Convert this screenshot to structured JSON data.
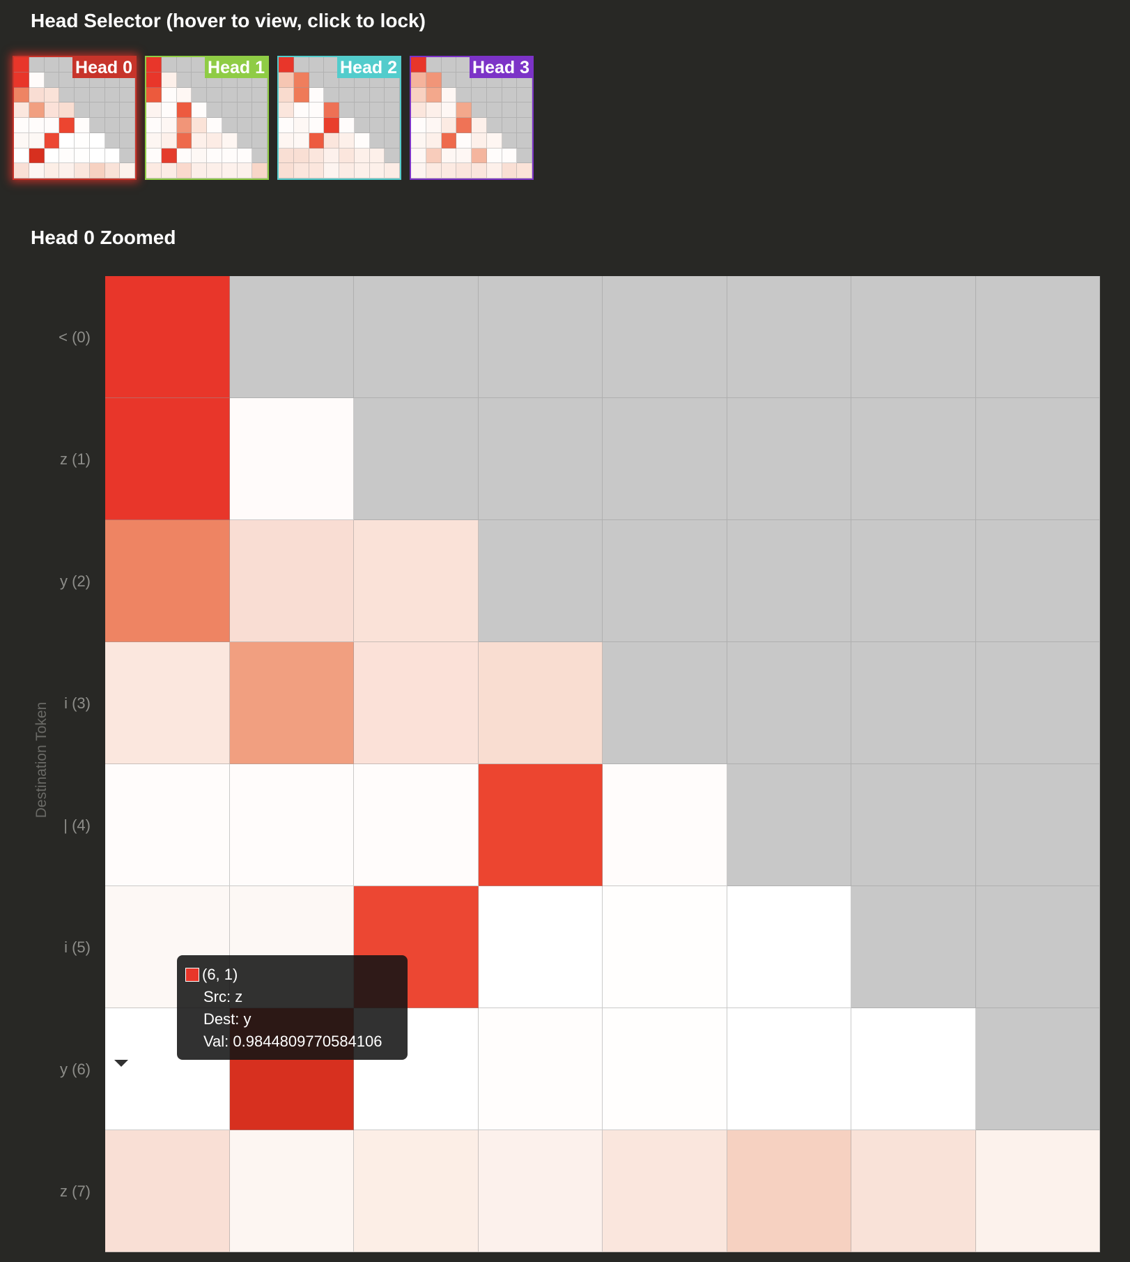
{
  "selector": {
    "title": "Head Selector (hover to view, click to lock)"
  },
  "zoom": {
    "title": "Head 0 Zoomed",
    "axis_label": "Destination Token"
  },
  "tokens": [
    "< (0)",
    "z (1)",
    "y (2)",
    "i (3)",
    "| (4)",
    "i (5)",
    "y (6)",
    "z (7)"
  ],
  "masked_color": "#c8c8c8",
  "heads": [
    {
      "label": "Head 0",
      "color": "#c7342a",
      "active": true,
      "cells": [
        [
          "#e8362a",
          null,
          null,
          null,
          null,
          null,
          null,
          null
        ],
        [
          "#e8362a",
          "#fffbfa",
          null,
          null,
          null,
          null,
          null,
          null
        ],
        [
          "#ee8463",
          "#f9ddd3",
          "#fae2d8",
          null,
          null,
          null,
          null,
          null
        ],
        [
          "#fbe7de",
          "#f19f80",
          "#fbe1d8",
          "#f9ddd1",
          null,
          null,
          null,
          null
        ],
        [
          "#fffcfb",
          "#fffcfb",
          "#fffcfb",
          "#ec4530",
          "#fffcfb",
          null,
          null,
          null
        ],
        [
          "#fdf8f5",
          "#fdf8f5",
          "#ec4733",
          "#ffffff",
          "#fffefd",
          "#ffffff",
          null,
          null
        ],
        [
          "#ffffff",
          "#d7301f",
          "#ffffff",
          "#fffdfc",
          "#fffefd",
          "#ffffff",
          "#ffffff",
          null
        ],
        [
          "#f9dfd5",
          "#fdf6f2",
          "#fceee6",
          "#fcf1ec",
          "#fae6dd",
          "#f6d1c1",
          "#f9e2d8",
          "#fcf2ec"
        ]
      ]
    },
    {
      "label": "Head 1",
      "color": "#8fcc45",
      "active": false,
      "cells": [
        [
          "#e8362a",
          null,
          null,
          null,
          null,
          null,
          null,
          null
        ],
        [
          "#e8362a",
          "#fdf0ea",
          null,
          null,
          null,
          null,
          null,
          null
        ],
        [
          "#ec5a3d",
          "#fffcfb",
          "#fef7f4",
          null,
          null,
          null,
          null,
          null
        ],
        [
          "#fdf4f0",
          "#fffcfb",
          "#ed5a3f",
          "#fffcfb",
          null,
          null,
          null,
          null
        ],
        [
          "#fffcfb",
          "#fef7f4",
          "#f19578",
          "#fbe3d8",
          "#fffcfb",
          null,
          null,
          null
        ],
        [
          "#fdf6f2",
          "#fdf0ea",
          "#ee6a4c",
          "#fdf0ea",
          "#fcece5",
          "#fef6f2",
          null,
          null
        ],
        [
          "#fffcfb",
          "#e43c2c",
          "#fffcfb",
          "#fef8f5",
          "#fffcfb",
          "#fffcfb",
          "#fffcfb",
          null
        ],
        [
          "#fceae2",
          "#fcece5",
          "#fad9cd",
          "#fceee8",
          "#fcefe9",
          "#fdf1ec",
          "#fcf1ec",
          "#f8d6c8"
        ]
      ]
    },
    {
      "label": "Head 2",
      "color": "#53cccc",
      "active": false,
      "cells": [
        [
          "#e8362a",
          null,
          null,
          null,
          null,
          null,
          null,
          null
        ],
        [
          "#f6c6b3",
          "#ef7e5d",
          null,
          null,
          null,
          null,
          null,
          null
        ],
        [
          "#f9dbce",
          "#ef7a58",
          "#fffcfb",
          null,
          null,
          null,
          null,
          null
        ],
        [
          "#fbe6dd",
          "#fffcfb",
          "#fffcfb",
          "#ee7155",
          null,
          null,
          null,
          null
        ],
        [
          "#fffcfb",
          "#fef8f5",
          "#fffcfb",
          "#e93f2d",
          "#fffcfb",
          null,
          null,
          null
        ],
        [
          "#fef6f2",
          "#fef8f5",
          "#ed5b40",
          "#fbe6dd",
          "#fdf0ea",
          "#fffcfb",
          null,
          null
        ],
        [
          "#f9dfd4",
          "#f9dfd4",
          "#fbe6dd",
          "#fdf1ec",
          "#fbe6dd",
          "#fdf0ea",
          "#fdf0ea",
          null
        ],
        [
          "#f9dfd4",
          "#fbe6dd",
          "#fbe6dd",
          "#fdf4f0",
          "#fcece5",
          "#fdf0ea",
          "#fdf0ea",
          "#fcece5"
        ]
      ]
    },
    {
      "label": "Head 3",
      "color": "#7c33c7",
      "active": false,
      "cells": [
        [
          "#e8362a",
          null,
          null,
          null,
          null,
          null,
          null,
          null
        ],
        [
          "#f5b39c",
          "#f19578",
          null,
          null,
          null,
          null,
          null,
          null
        ],
        [
          "#f8d1c1",
          "#f3a88c",
          "#fef7f4",
          null,
          null,
          null,
          null,
          null
        ],
        [
          "#fbe6dd",
          "#fdf0ea",
          "#fef7f4",
          "#f3a88c",
          null,
          null,
          null,
          null
        ],
        [
          "#fffcfb",
          "#fef7f4",
          "#fcebe3",
          "#ef7356",
          "#fdf0ea",
          null,
          null,
          null
        ],
        [
          "#fdf6f2",
          "#fdf0ea",
          "#ee6a4c",
          "#fffcfb",
          "#fdf0ea",
          "#fef6f2",
          null,
          null
        ],
        [
          "#fef7f4",
          "#f8ccbb",
          "#fef7f4",
          "#fef7f4",
          "#f4b59e",
          "#fffcfb",
          "#fffcfb",
          null
        ],
        [
          "#fdf4f0",
          "#fceae2",
          "#fceae2",
          "#fbe6dd",
          "#fbe6dd",
          "#fdf0ea",
          "#f9dfd4",
          "#fbe3d8"
        ]
      ]
    }
  ],
  "tooltip": {
    "position": "(6, 1)",
    "src": "Src: z",
    "dest": "Dest: y",
    "val": "Val: 0.9844809770584106",
    "swatch_color": "#e8362a"
  }
}
